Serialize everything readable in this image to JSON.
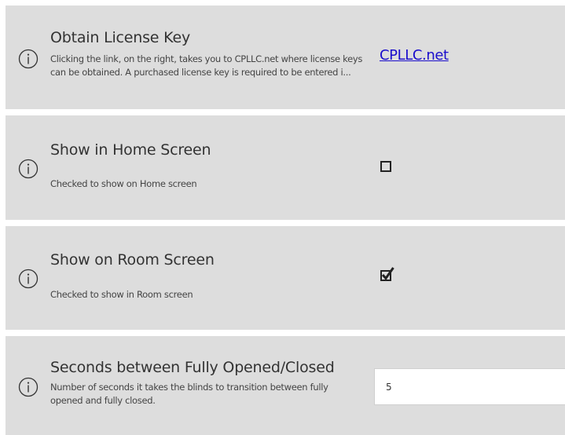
{
  "settings": [
    {
      "title": "Obtain License Key",
      "description": "Clicking the link, on the right, takes you to CPLLC.net where license keys can be obtained.  A purchased license key is required to be entered i...",
      "control": {
        "type": "link",
        "label": "CPLLC.net"
      }
    },
    {
      "title": "Show in Home Screen",
      "description": "Checked to show on Home screen",
      "control": {
        "type": "checkbox",
        "checked": false
      }
    },
    {
      "title": "Show on Room Screen",
      "description": "Checked to show in Room screen",
      "control": {
        "type": "checkbox",
        "checked": true
      }
    },
    {
      "title": "Seconds between Fully Opened/Closed",
      "description": "Number of seconds it takes the blinds to transition between fully opened and fully closed.",
      "control": {
        "type": "number-input",
        "value": "5"
      }
    }
  ],
  "icons": {
    "info": "info-circle-icon",
    "check": "checkmark-icon"
  },
  "colors": {
    "row_background": "#dddddd",
    "link": "#1a0dcc",
    "text": "#333333"
  }
}
